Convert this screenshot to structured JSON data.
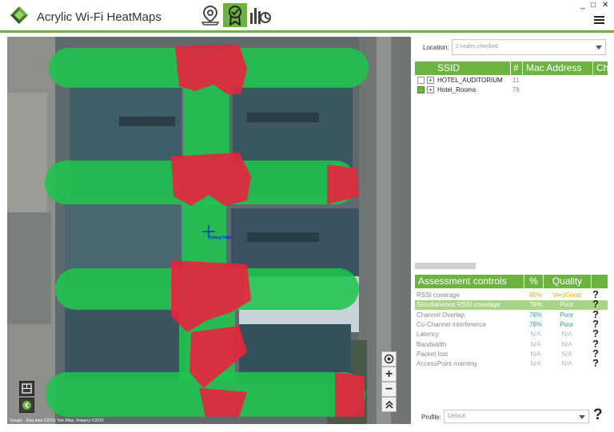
{
  "app": {
    "title": "Acrylic Wi-Fi HeatMaps"
  },
  "window": {
    "minimize": "_",
    "maximize": "□",
    "close": "✕"
  },
  "toolbar": {
    "tools": [
      {
        "icon": "map-pin-icon",
        "active": false
      },
      {
        "icon": "badge-check-icon",
        "active": true
      },
      {
        "icon": "report-chart-icon",
        "active": false
      }
    ]
  },
  "map": {
    "attribution": "Google · Map data ©2016 Tele Atlas, Imagery ©2016",
    "node_label": "Debug Node",
    "controls": [
      "locate-icon",
      "+",
      "−",
      "»"
    ]
  },
  "location": {
    "label": "Location:",
    "value": "2 nodes checked"
  },
  "ssid_table": {
    "columns": [
      "SSID",
      "#",
      "Mac Address",
      "Ch"
    ],
    "rows": [
      {
        "name": "HOTEL_AUDITORIUM",
        "count": "11",
        "checked": false
      },
      {
        "name": "Hotel_Rooms",
        "count": "76",
        "checked": true
      }
    ]
  },
  "assessment": {
    "columns": [
      "Assessment controls",
      "%",
      "Quality"
    ],
    "rows": [
      {
        "name": "RSSI coverage",
        "pct": "95%",
        "quality": "VeryGood",
        "color": "#e6a800",
        "highlight": false
      },
      {
        "name": "Simultaneous RSSI coverage",
        "pct": "78%",
        "quality": "Poor",
        "color": "#ffffff",
        "highlight": true
      },
      {
        "name": "Channel Overlap",
        "pct": "76%",
        "quality": "Poor",
        "color": "#1a9fd9",
        "highlight": false
      },
      {
        "name": "Co-Channel interference",
        "pct": "78%",
        "quality": "Poor",
        "color": "#1a9fd9",
        "highlight": false
      },
      {
        "name": "Latency",
        "pct": "N/A",
        "quality": "N/A",
        "color": "#b5b5b5",
        "highlight": false
      },
      {
        "name": "Bandwidth",
        "pct": "N/A",
        "quality": "N/A",
        "color": "#b5b5b5",
        "highlight": false
      },
      {
        "name": "Packet lost",
        "pct": "N/A",
        "quality": "N/A",
        "color": "#b5b5b5",
        "highlight": false
      },
      {
        "name": "AccessPoint roaming",
        "pct": "N/A",
        "quality": "N/A",
        "color": "#b5b5b5",
        "highlight": false
      }
    ],
    "help_glyph": "?"
  },
  "profile": {
    "label": "Profile:",
    "value": "Default",
    "help_glyph": "?"
  },
  "colors": {
    "accent": "#6db33f",
    "heat_good": "#1fc44e",
    "heat_bad": "#e8233e"
  }
}
